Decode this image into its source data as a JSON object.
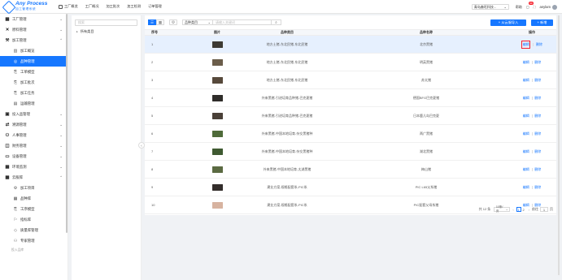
{
  "brand": {
    "title": "Any Process",
    "subtitle": "加工管理系统"
  },
  "topnav": [
    "工厂概览",
    "工厂概况",
    "加工批次",
    "加工检测",
    "订单管理"
  ],
  "top_right": {
    "select_value": "青岛森旺科技...",
    "help_label": "帮助",
    "notif_count": "99",
    "user_name": "anylam"
  },
  "sidebar": {
    "items": [
      {
        "label": "工厂管理",
        "icon": "factory-icon",
        "glyph": "▦",
        "level": 0,
        "chevron": "⌄"
      },
      {
        "label": "原料管理",
        "icon": "cross-tools-icon",
        "glyph": "✕",
        "level": 0,
        "chevron": "⌄"
      },
      {
        "label": "加工管理",
        "icon": "wrench-icon",
        "glyph": "⚒",
        "level": 0,
        "chevron": "⌃"
      },
      {
        "label": "加工概览",
        "icon": "bar-chart-icon",
        "glyph": "▥",
        "level": 1
      },
      {
        "label": "品种管理",
        "icon": "target-icon",
        "glyph": "◎",
        "level": 1,
        "active": true
      },
      {
        "label": "工单模型",
        "icon": "ticket-icon",
        "glyph": "⎘",
        "level": 1
      },
      {
        "label": "加工批次",
        "icon": "batch-icon",
        "glyph": "⎘",
        "level": 1
      },
      {
        "label": "加工任务",
        "icon": "task-icon",
        "glyph": "⎘",
        "level": 1
      },
      {
        "label": "运输管理",
        "icon": "truck-icon",
        "glyph": "▤",
        "level": 1
      },
      {
        "label": "投入品管理",
        "icon": "input-icon",
        "glyph": "▣",
        "level": 0,
        "chevron": "⌄"
      },
      {
        "label": "溯源管理",
        "icon": "trace-icon",
        "glyph": "⇄",
        "level": 0,
        "chevron": "⌄"
      },
      {
        "label": "人事管理",
        "icon": "user-icon",
        "glyph": "⚇",
        "level": 0,
        "chevron": "⌄"
      },
      {
        "label": "财务管理",
        "icon": "finance-icon",
        "glyph": "◫",
        "level": 0,
        "chevron": "⌄"
      },
      {
        "label": "设备管理",
        "icon": "device-icon",
        "glyph": "▭",
        "level": 0,
        "chevron": "⌄"
      },
      {
        "label": "环境监测",
        "icon": "environment-icon",
        "glyph": "▦",
        "level": 0,
        "chevron": "⌄"
      },
      {
        "label": "云服库",
        "icon": "cloud-lib-icon",
        "glyph": "▩",
        "level": 0,
        "chevron": "⌃"
      },
      {
        "label": "加工项目",
        "icon": "project-icon",
        "glyph": "⚙",
        "level": 1
      },
      {
        "label": "品种库",
        "icon": "variety-icon",
        "glyph": "▦",
        "level": 1
      },
      {
        "label": "工序模型",
        "icon": "process-icon",
        "glyph": "⎘",
        "level": 1
      },
      {
        "label": "指标库",
        "icon": "flag-icon",
        "glyph": "⚐",
        "level": 1
      },
      {
        "label": "质量库管理",
        "icon": "quality-icon",
        "glyph": "◇",
        "level": 1
      },
      {
        "label": "专家管理",
        "icon": "expert-icon",
        "glyph": "⚇",
        "level": 1
      }
    ],
    "group_label": "投入品库"
  },
  "tree": {
    "search_placeholder": "搜索",
    "root": "所有类目"
  },
  "toolbar": {
    "field_select": "品种类目",
    "search_placeholder": "请输入关键词",
    "import_label": "+ 从云服导入",
    "add_label": "+ 新增"
  },
  "table": {
    "headers": {
      "no": "序号",
      "image": "图片",
      "category": "品种类目",
      "name": "品种名称",
      "actions": "操作"
    },
    "edit_label": "编辑",
    "delete_label": "删除",
    "rows": [
      {
        "no": "1",
        "category": "地方土猪-东北民猪-东北民猪",
        "name": "北京黑猪",
        "thumb": "#3d3a33",
        "highlight": true
      },
      {
        "no": "2",
        "category": "地方土猪-东北民猪-东北民猪",
        "name": "明英黑猪",
        "thumb": "#6b5d4a"
      },
      {
        "no": "3",
        "category": "地方土猪-东北民猪-东北民猪",
        "name": "苏太猪",
        "thumb": "#57493b"
      },
      {
        "no": "4",
        "category": "外来黑猪-引进培育品种猪-巴克夏猪",
        "name": "德国BFG巴克夏猪",
        "thumb": "#2f2d2a"
      },
      {
        "no": "5",
        "category": "外来黑猪-引进培育品种猪-巴克夏猪",
        "name": "日本鹿儿岛巴克夏",
        "thumb": "#4a4038"
      },
      {
        "no": "6",
        "category": "外来黑猪-中国本地培育-杂交黑猪种",
        "name": "两广黑猪",
        "thumb": "#4f6b3a"
      },
      {
        "no": "7",
        "category": "外来黑猪-中国本地培育-杂交黑猪种",
        "name": "湖北黑猪",
        "thumb": "#3f5a31"
      },
      {
        "no": "8",
        "category": "外来黑猪-中国本地培育-太湖黑猪",
        "name": "梅山猪",
        "thumb": "#5b6a42"
      },
      {
        "no": "9",
        "category": "建业方案-规格配套系-PIC系",
        "name": "PIC L65父系猪",
        "thumb": "#332d2b"
      },
      {
        "no": "10",
        "category": "建业方案-规格配套系-PIC系",
        "name": "PIC配套父母系猪",
        "thumb": "#d7b3a0"
      }
    ]
  },
  "pager": {
    "total": "共 12 条",
    "page_size": "10条/页",
    "pages": [
      "1",
      "2"
    ],
    "current": "1",
    "goto_label": "前往",
    "goto_value": "1",
    "page_unit": "页"
  }
}
